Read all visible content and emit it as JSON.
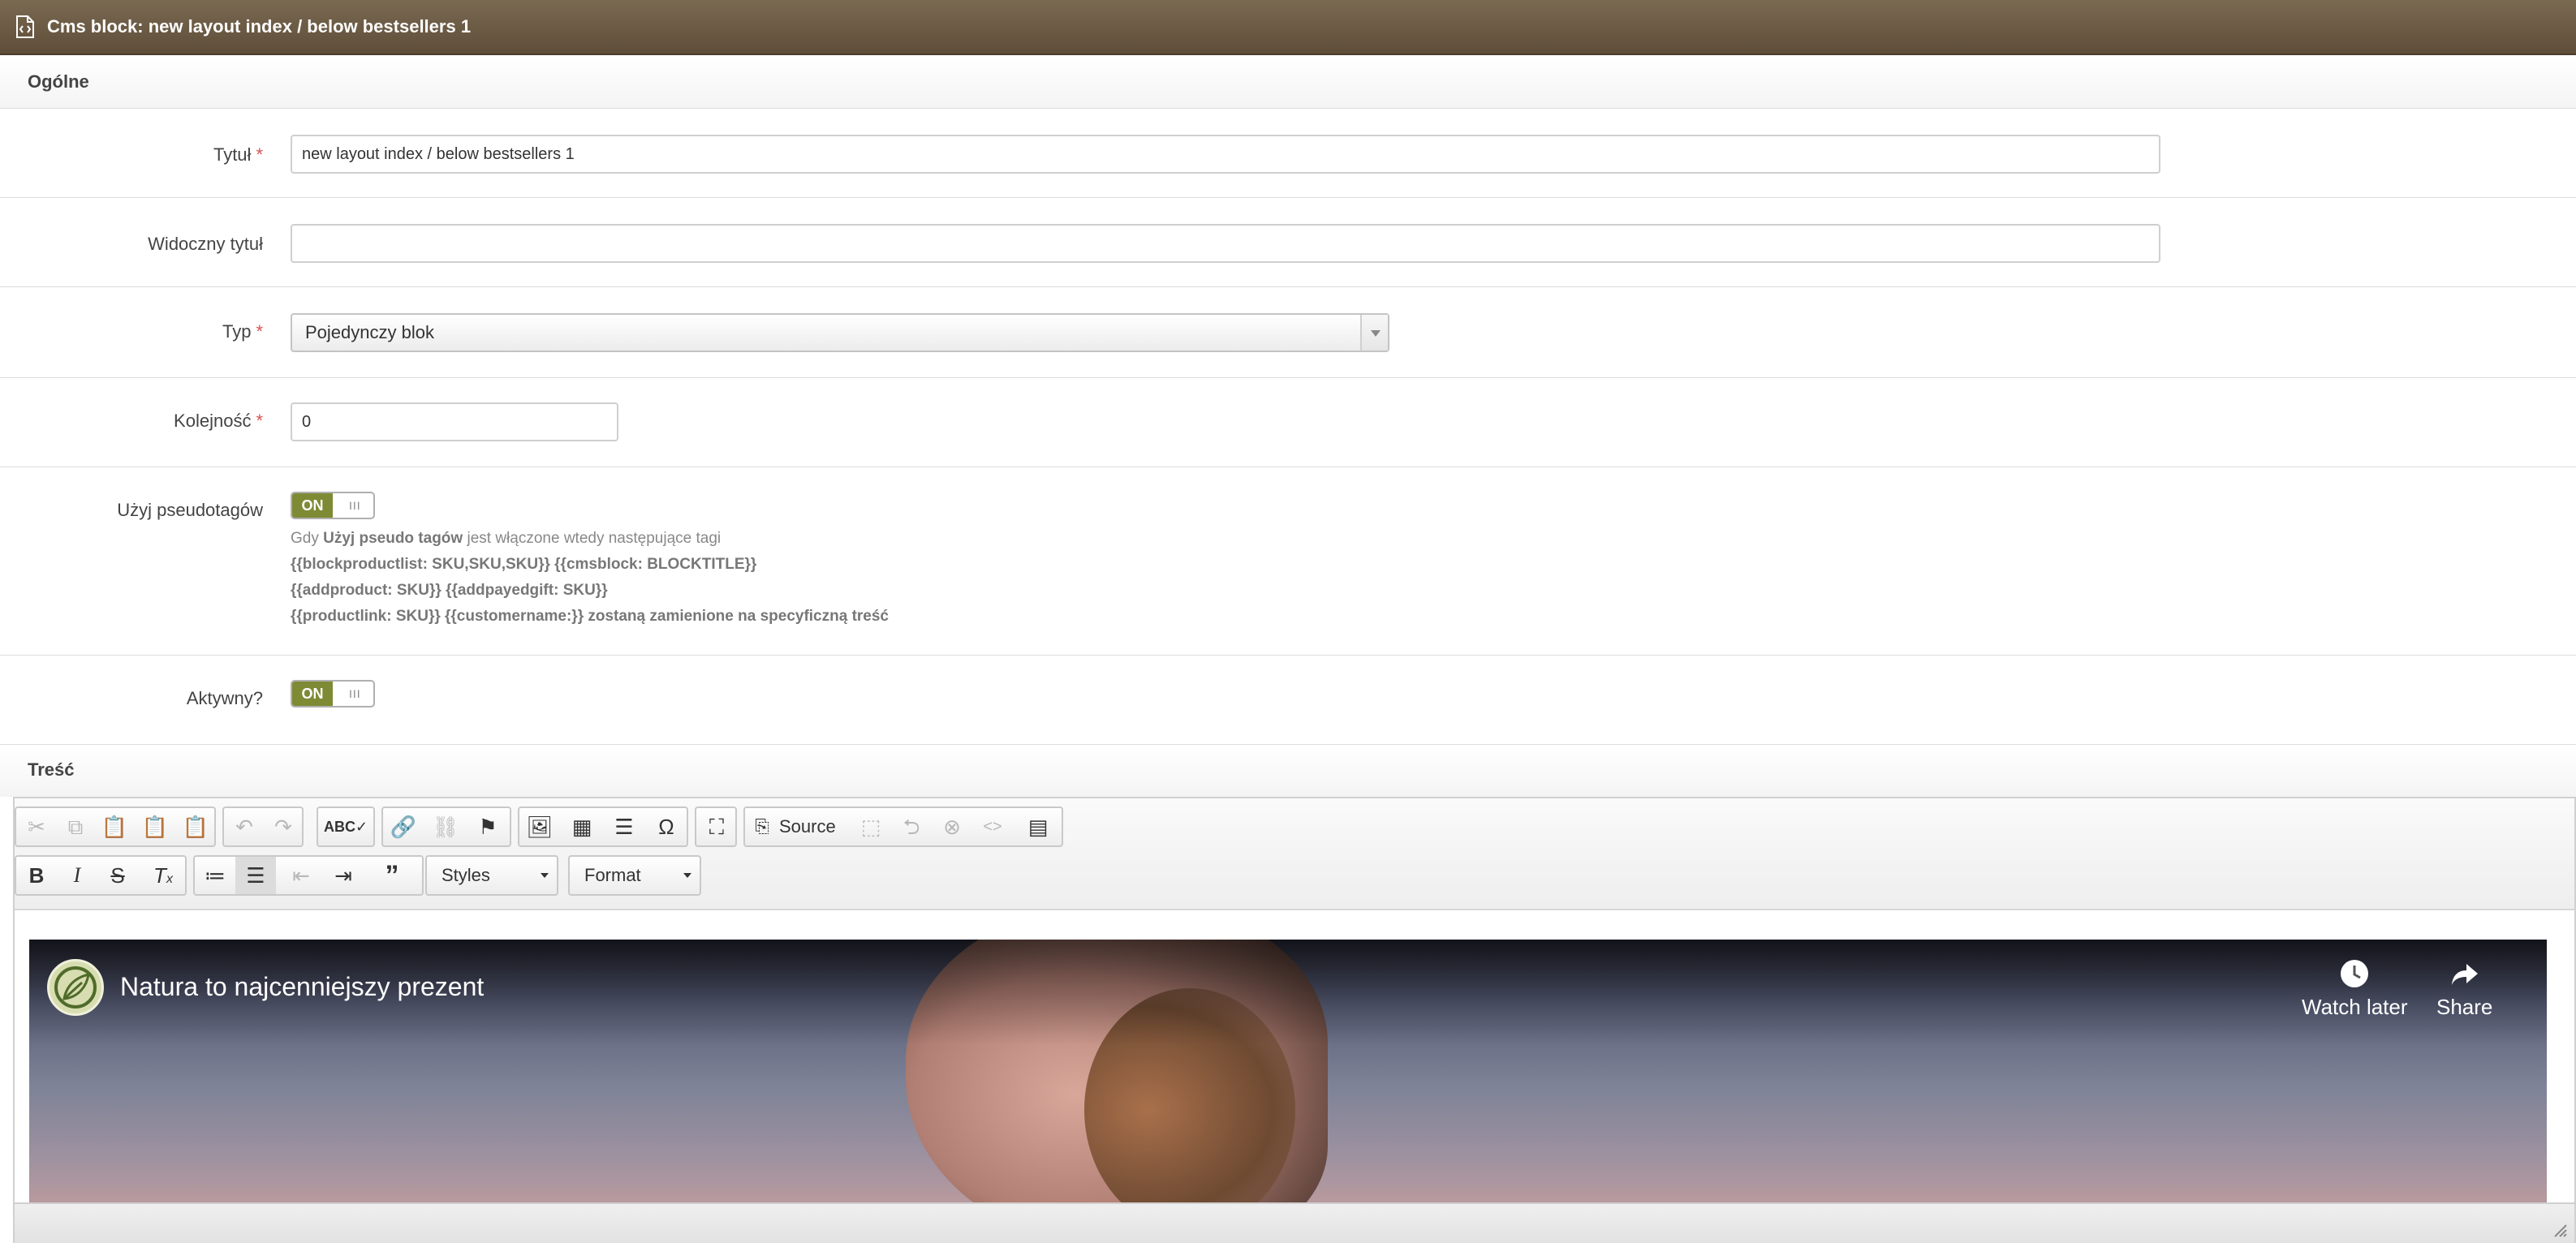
{
  "window": {
    "title": "Cms block: new layout index / below bestsellers 1"
  },
  "sections": {
    "general": "Ogólne",
    "content": "Treść"
  },
  "fields": {
    "title": {
      "label": "Tytuł",
      "required": "*",
      "value": "new layout index / below bestsellers 1"
    },
    "visible_title": {
      "label": "Widoczny tytuł",
      "value": ""
    },
    "type": {
      "label": "Typ",
      "required": "*",
      "selected": "Pojedynczy blok"
    },
    "order": {
      "label": "Kolejność",
      "required": "*",
      "value": "0"
    },
    "pseudo_tags": {
      "label": "Użyj pseudotagów",
      "toggle": "ON",
      "help": {
        "line1_prefix": "Gdy ",
        "line1_bold": "Użyj pseudo tagów",
        "line1_suffix": " jest włączone wtedy następujące tagi",
        "line2": "{{blockproductlist: SKU,SKU,SKU}} {{cmsblock: BLOCKTITLE}}",
        "line3": "{{addproduct: SKU}} {{addpayedgift: SKU}}",
        "line4": "{{productlink: SKU}} {{customername:}} zostaną zamienione na specyficzną treść"
      }
    },
    "active": {
      "label": "Aktywny?",
      "toggle": "ON"
    }
  },
  "editor": {
    "toolbar_row1": {
      "source_label": "Source"
    },
    "toolbar_row2": {
      "styles_label": "Styles",
      "format_label": "Format"
    },
    "video": {
      "title": "Natura to najcenniejszy prezent",
      "watch_later": "Watch later",
      "share": "Share"
    }
  },
  "colors": {
    "titlebar": "#6b5a43",
    "toggle_on": "#7f8a35",
    "required": "#d9534f"
  }
}
